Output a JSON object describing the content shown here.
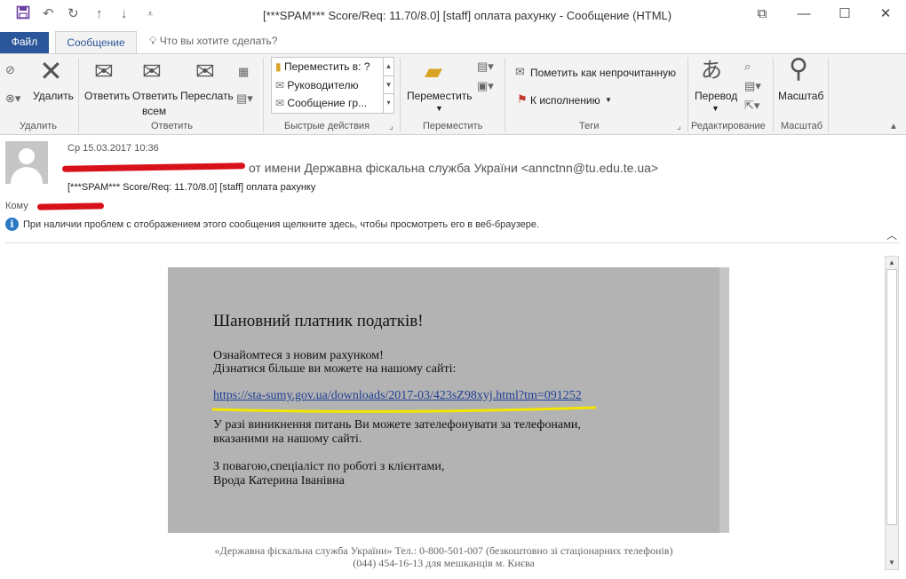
{
  "quick_access": {
    "save_icon": "save-icon",
    "undo_icon": "undo-icon",
    "redo_icon": "redo-icon",
    "up_icon": "arrow-up-icon",
    "down_icon": "arrow-down-icon",
    "customize_icon": "customize-icon"
  },
  "window": {
    "title": "[***SPAM*** Score/Req: 11.70/8.0] [staff] оплата рахунку  -  Сообщение (HTML)"
  },
  "tabs": {
    "file": "Файл",
    "message": "Сообщение",
    "tell_me": "Что вы хотите сделать?"
  },
  "ribbon": {
    "delete_group": {
      "delete": "Удалить",
      "label": "Удалить"
    },
    "respond_group": {
      "reply": "Ответить",
      "reply_all_line1": "Ответить",
      "reply_all_line2": "всем",
      "forward": "Переслать",
      "label": "Ответить"
    },
    "quick_steps": {
      "items": [
        "Переместить в: ?",
        "Руководителю",
        "Сообщение гр..."
      ],
      "label": "Быстрые действия"
    },
    "move_group": {
      "move": "Переместить",
      "label": "Переместить"
    },
    "tags_group": {
      "mark_unread": "Пометить как непрочитанную",
      "follow_up": "К исполнению",
      "label": "Теги"
    },
    "editing_group": {
      "translate": "Перевод",
      "label": "Редактирование"
    },
    "zoom_group": {
      "zoom": "Масштаб",
      "label": "Масштаб"
    }
  },
  "header": {
    "date": "Ср 15.03.2017 10:36",
    "from": "от имени Державна фіскальна служба України <annctnn@tu.edu.te.ua>",
    "subject": "[***SPAM*** Score/Req: 11.70/8.0] [staff] оплата рахунку",
    "to_label": "Кому",
    "info": "При наличии проблем с отображением этого сообщения щелкните здесь, чтобы просмотреть его в веб-браузере."
  },
  "message": {
    "greeting": "Шановний платник податків!",
    "line1": "Ознайомтеся з новим рахунком!",
    "line2": "Дізнатися більше ви можете на нашому сайті:",
    "link": "https://sta-sumy.gov.ua/downloads/2017-03/423sZ98xyj.html?tm=091252",
    "line3": "У разі виникнення питань Ви можете зателефонувати за телефонами,",
    "line4": "вказаними на нашому сайті.",
    "line5": "З повагою,спеціаліст по роботі з клієнтами,",
    "line6": "Врода Катерина Іванівна"
  },
  "footer": {
    "line1": "«Державна фіскальна служба України» Тел.: 0-800-501-007 (безкоштовно зі стаціонарних телефонів)",
    "line2": "(044) 454-16-13 для мешканців м. Києва"
  },
  "colors": {
    "accent": "#2b579a",
    "message_panel": "#b3b3b3",
    "redaction": "#d8101a",
    "highlight": "#f2e600"
  }
}
